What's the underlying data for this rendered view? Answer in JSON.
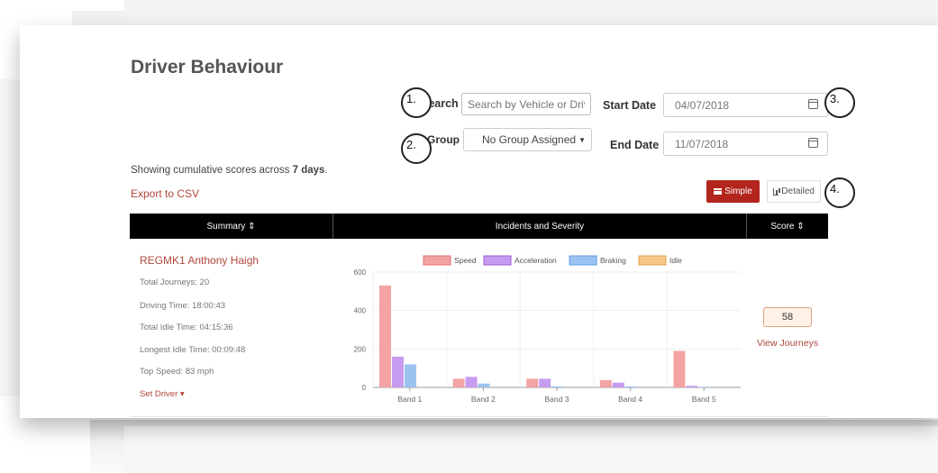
{
  "page": {
    "title": "Driver Behaviour"
  },
  "filters": {
    "search_label": "Search",
    "search_placeholder": "Search by Vehicle or Driv",
    "group_label": "Group",
    "group_value": "No Group Assigned",
    "start_date_label": "Start Date",
    "start_date_value": "04/07/2018",
    "end_date_label": "End Date",
    "end_date_value": "11/07/2018"
  },
  "callouts": [
    "1.",
    "2.",
    "3.",
    "4."
  ],
  "summary": {
    "prefix": "Showing cumulative scores across ",
    "days": "7 days",
    "suffix": ".",
    "export_label": "Export to CSV"
  },
  "view_toggle": {
    "simple_label": "Simple",
    "detailed_label": "Detailed"
  },
  "table": {
    "headers": {
      "summary": "Summary ⇕",
      "incidents": "Incidents and Severity",
      "score": "Score ⇕"
    },
    "row": {
      "driver": "REGMK1 Anthony Haigh",
      "stats": [
        "Total Journeys: 20",
        "Driving Time: 18:00:43",
        "Total Idle Time: 04:15:36",
        "Longest Idle Time: 00:09:48",
        "Top Speed: 83 mph"
      ],
      "set_driver": "Set Driver ▾",
      "score": "58",
      "view_journeys": "View Journeys"
    }
  },
  "chart_data": {
    "type": "bar",
    "categories": [
      "Band 1",
      "Band 2",
      "Band 3",
      "Band 4",
      "Band 5"
    ],
    "series": [
      {
        "name": "Speed",
        "values": [
          530,
          45,
          45,
          38,
          190
        ],
        "color": "#f3a3a3"
      },
      {
        "name": "Acceleration",
        "values": [
          160,
          55,
          45,
          25,
          8
        ],
        "color": "#c79cf0"
      },
      {
        "name": "Braking",
        "values": [
          120,
          20,
          5,
          5,
          3
        ],
        "color": "#9cc3f0"
      },
      {
        "name": "Idle",
        "values": [
          0,
          0,
          0,
          0,
          0
        ],
        "color": "#f5c88a"
      }
    ],
    "ylim": [
      0,
      600
    ],
    "yticks": [
      "0",
      "200",
      "400",
      "600"
    ],
    "legend": "top",
    "grid": true,
    "xlabel": "",
    "ylabel": ""
  }
}
